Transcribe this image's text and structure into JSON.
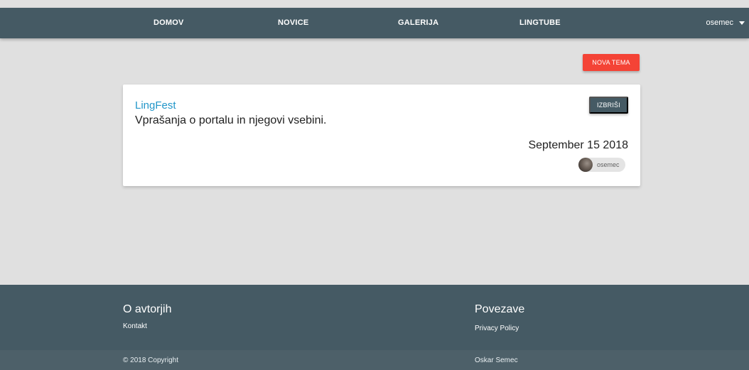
{
  "navbar": {
    "links": [
      "DOMOV",
      "NOVICE",
      "GALERIJA",
      "LINGTUBE"
    ],
    "user": "osemec"
  },
  "actions": {
    "new_topic": "NOVA TEMA"
  },
  "topic": {
    "title": "LingFest",
    "description": "Vprašanja o portalu in njegovi vsebini.",
    "delete_label": "IZBRIŠI",
    "date": "September 15 2018",
    "author": "osemec"
  },
  "footer": {
    "about_heading": "O avtorjih",
    "contact_link": "Kontakt",
    "links_heading": "Povezave",
    "privacy_link": "Privacy Policy",
    "copyright": "© 2018 Copyright",
    "author_name": "Oskar Semec"
  },
  "colors": {
    "navbar": "#455a64",
    "accent_red": "#f44336",
    "link_blue": "#2196c9",
    "background": "#e0e0e0"
  }
}
